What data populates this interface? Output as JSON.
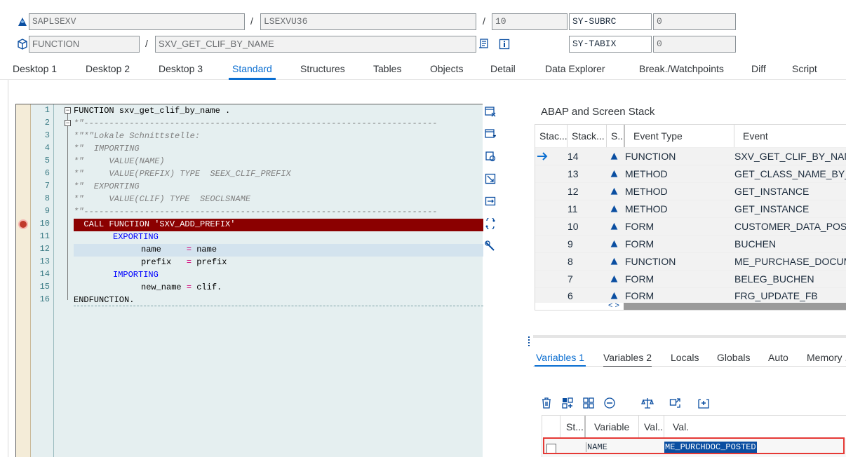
{
  "header": {
    "row1": {
      "program": "SAPLSEXV",
      "include": "LSEXVU36",
      "line": "10",
      "sysvar": "SY-SUBRC",
      "sysval": "0"
    },
    "row2": {
      "event_type": "FUNCTION",
      "event": "SXV_GET_CLIF_BY_NAME",
      "sysvar": "SY-TABIX",
      "sysval": "0"
    },
    "separator": "/"
  },
  "tabs": [
    "Desktop 1",
    "Desktop 2",
    "Desktop 3",
    "Standard",
    "Structures",
    "Tables",
    "Objects",
    "Detail",
    "Data Explorer",
    "Break./Watchpoints",
    "Diff",
    "Script"
  ],
  "active_tab": "Standard",
  "editor": {
    "line_numbers": [
      "1",
      "2",
      "3",
      "4",
      "5",
      "6",
      "7",
      "8",
      "9",
      "10",
      "11",
      "12",
      "13",
      "14",
      "15",
      "16"
    ],
    "l1_kw": "FUNCTION",
    "l1_rest": " sxv_get_clif_by_name .",
    "l2": "*\"----------------------------------------------------------------------",
    "l3": "*\"*\"Lokale Schnittstelle:",
    "l4": "*\"  IMPORTING",
    "l5": "*\"     VALUE(NAME)",
    "l6": "*\"     VALUE(PREFIX) TYPE  SEEX_CLIF_PREFIX",
    "l7": "*\"  EXPORTING",
    "l8": "*\"     VALUE(CLIF) TYPE  SEOCLSNAME",
    "l9": "*\"----------------------------------------------------------------------",
    "l10": "  CALL FUNCTION 'SXV_ADD_PREFIX'",
    "l11": "EXPORTING",
    "l12_a": "name",
    "l12_op": "=",
    "l12_b": "name",
    "l13_a": "prefix",
    "l13_op": "=",
    "l13_b": "prefix",
    "l14": "IMPORTING",
    "l15_a": "new_name",
    "l15_op": "=",
    "l15_b": "clif.",
    "l16_kw": "ENDFUNCTION",
    "l16_rest": "."
  },
  "stack": {
    "title": "ABAP and Screen Stack",
    "headers": [
      "Stac...",
      "Stack...",
      "S...",
      "Event Type",
      "Event"
    ],
    "rows": [
      {
        "level": "14",
        "type": "FUNCTION",
        "event": "SXV_GET_CLIF_BY_NAME"
      },
      {
        "level": "13",
        "type": "METHOD",
        "event": "GET_CLASS_NAME_BY_INTERFACE"
      },
      {
        "level": "12",
        "type": "METHOD",
        "event": "GET_INSTANCE"
      },
      {
        "level": "11",
        "type": "METHOD",
        "event": "GET_INSTANCE"
      },
      {
        "level": "10",
        "type": "FORM",
        "event": "CUSTOMER_DATA_POST"
      },
      {
        "level": "9",
        "type": "FORM",
        "event": "BUCHEN"
      },
      {
        "level": "8",
        "type": "FUNCTION",
        "event": "ME_PURCHASE_DOCUMENT_POST"
      },
      {
        "level": "7",
        "type": "FORM",
        "event": "BELEG_BUCHEN"
      },
      {
        "level": "6",
        "type": "FORM",
        "event": "FRG_UPDATE_FB"
      }
    ],
    "scroll_arrows": "< >"
  },
  "var_tabs": [
    "Variables 1",
    "Variables 2",
    "Locals",
    "Globals",
    "Auto",
    "Memory ..."
  ],
  "vars": {
    "headers": [
      "St...",
      "Variable",
      "Val...",
      "Val."
    ],
    "row": {
      "variable": "NAME",
      "value": "ME_PURCHDOC_POSTED"
    }
  },
  "colors": {
    "accent": "#0a6ed1",
    "breakpoint_line": "#8b0000",
    "highlight_box": "#e53935"
  }
}
